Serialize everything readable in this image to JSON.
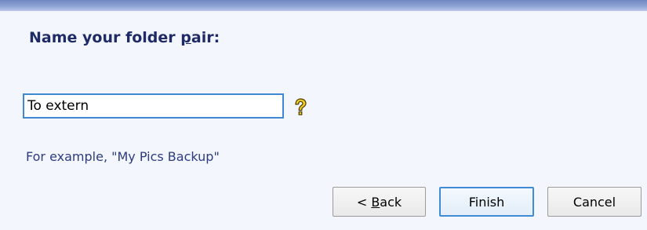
{
  "heading": {
    "prefix": "Name your folder ",
    "mnemonic": "p",
    "suffix": "air:"
  },
  "folder_name_input": {
    "value": "To extern",
    "placeholder": ""
  },
  "hint": "For example, \"My Pics Backup\"",
  "buttons": {
    "back": {
      "prefix": "< ",
      "mnemonic": "B",
      "suffix": "ack"
    },
    "finish": "Finish",
    "cancel": "Cancel"
  },
  "icons": {
    "help": "help-key-icon"
  },
  "colors": {
    "accent": "#3f88d4",
    "heading": "#1f2b66",
    "hint": "#2d3c82",
    "background": "#f3f6fd",
    "top_band": "#7e95cc"
  }
}
